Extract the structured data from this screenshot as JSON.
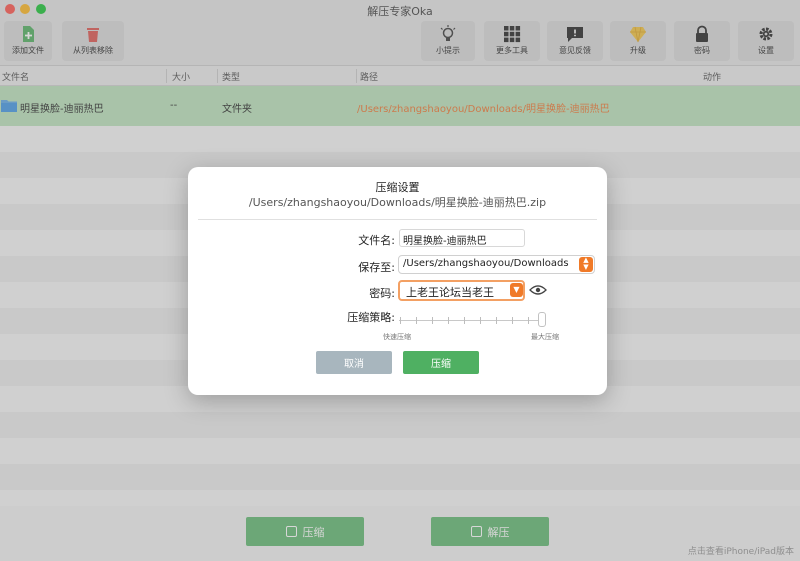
{
  "window": {
    "title": "解压专家Oka"
  },
  "toolbar": {
    "add_file": "添加文件",
    "remove_from_list": "从列表移除",
    "tips": "小提示",
    "more_tools": "更多工具",
    "feedback": "意见反馈",
    "upgrade": "升级",
    "password": "密码",
    "settings": "设置"
  },
  "columns": {
    "name": "文件名",
    "size": "大小",
    "type": "类型",
    "path": "路径",
    "action": "动作"
  },
  "files": [
    {
      "name": "明星换脸-迪丽热巴",
      "size": "--",
      "type": "文件夹",
      "path": "/Users/zhangshaoyou/Downloads/明星换脸-迪丽热巴"
    }
  ],
  "dialog": {
    "title": "压缩设置",
    "subtitle": "/Users/zhangshaoyou/Downloads/明星换脸-迪丽热巴.zip",
    "filename_label": "文件名:",
    "filename_value": "明星换脸-迪丽热巴",
    "saveto_label": "保存至:",
    "saveto_value": "/Users/zhangshaoyou/Downloads",
    "password_label": "密码:",
    "password_value": "上老王论坛当老王",
    "strategy_label": "压缩策略:",
    "strategy_min": "快速压缩",
    "strategy_max": "最大压缩",
    "strategy_level": 1.0,
    "cancel": "取消",
    "confirm": "压缩"
  },
  "bottom": {
    "compress": "压缩",
    "extract": "解压",
    "ipad_link": "点击查看iPhone/iPad版本"
  },
  "colors": {
    "accent_green": "#4fb062",
    "accent_orange": "#f07a28",
    "row_highlight": "#bfe3bf"
  }
}
